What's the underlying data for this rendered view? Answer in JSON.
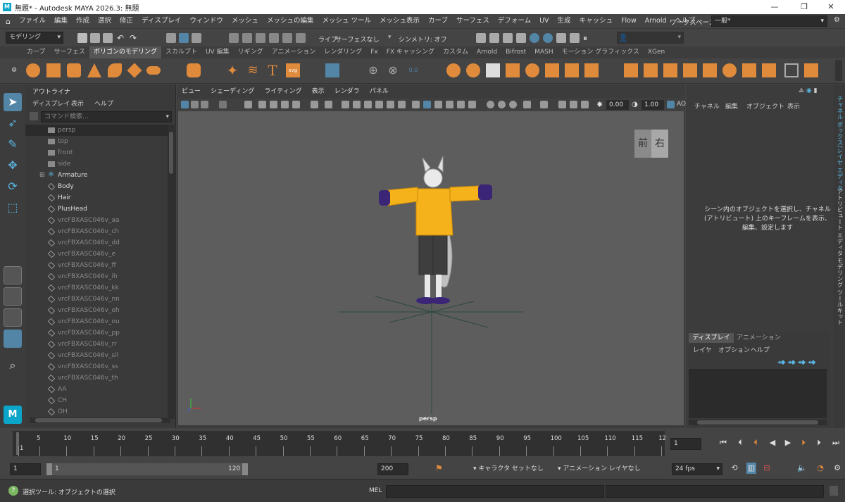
{
  "window": {
    "title": "無題* - Autodesk MAYA 2026.3: 無題",
    "logo": "M",
    "minimize": "—",
    "maximize": "❐",
    "close": "✕"
  },
  "menu": {
    "items": [
      "ファイル",
      "編集",
      "作成",
      "選択",
      "修正",
      "ディスプレイ",
      "ウィンドウ",
      "メッシュ",
      "メッシュの編集",
      "メッシュ ツール",
      "メッシュ表示",
      "カーブ",
      "サーフェス",
      "デフォーム",
      "UV",
      "生成",
      "キャッシュ",
      "Flow",
      "Arnold",
      "ヘルプ"
    ],
    "workspace_label": "ワークスペース:",
    "workspace_value": "一般*"
  },
  "status": {
    "mode": "モデリング",
    "live": "ライブ",
    "surface": "サーフェスなし",
    "symmetry": "シンメトリ: オフ"
  },
  "shelf_tabs": [
    "カーブ",
    "サーフェス",
    "ポリゴンのモデリング",
    "スカルプト",
    "UV 編集",
    "リギング",
    "アニメーション",
    "レンダリング",
    "Fx",
    "FX キャッシング",
    "カスタム",
    "Arnold",
    "Bifrost",
    "MASH",
    "モーション グラフィックス",
    "XGen"
  ],
  "shelf_active_tab": 2,
  "outliner": {
    "title": "アウトライナ",
    "menus": [
      "ディスプレイ",
      "表示",
      "ヘルプ"
    ],
    "search_placeholder": "コマンド検索...",
    "items": [
      {
        "name": "persp",
        "icon": "camera-icon",
        "style": "dim",
        "sel": true
      },
      {
        "name": "top",
        "icon": "camera-icon",
        "style": "dim"
      },
      {
        "name": "front",
        "icon": "camera-icon",
        "style": "dim"
      },
      {
        "name": "side",
        "icon": "camera-icon",
        "style": "dim"
      },
      {
        "name": "Armature",
        "icon": "joint-icon",
        "style": "lit",
        "expand": true
      },
      {
        "name": "Body",
        "icon": "mesh-icon",
        "style": "lit"
      },
      {
        "name": "Hair",
        "icon": "mesh-icon",
        "style": "lit"
      },
      {
        "name": "PlusHead",
        "icon": "mesh-icon",
        "style": "lit"
      },
      {
        "name": "vrcFBXASC046v_aa",
        "icon": "mesh-icon",
        "style": "dim"
      },
      {
        "name": "vrcFBXASC046v_ch",
        "icon": "mesh-icon",
        "style": "dim"
      },
      {
        "name": "vrcFBXASC046v_dd",
        "icon": "mesh-icon",
        "style": "dim"
      },
      {
        "name": "vrcFBXASC046v_e",
        "icon": "mesh-icon",
        "style": "dim"
      },
      {
        "name": "vrcFBXASC046v_ff",
        "icon": "mesh-icon",
        "style": "dim"
      },
      {
        "name": "vrcFBXASC046v_ih",
        "icon": "mesh-icon",
        "style": "dim"
      },
      {
        "name": "vrcFBXASC046v_kk",
        "icon": "mesh-icon",
        "style": "dim"
      },
      {
        "name": "vrcFBXASC046v_nn",
        "icon": "mesh-icon",
        "style": "dim"
      },
      {
        "name": "vrcFBXASC046v_oh",
        "icon": "mesh-icon",
        "style": "dim"
      },
      {
        "name": "vrcFBXASC046v_ou",
        "icon": "mesh-icon",
        "style": "dim"
      },
      {
        "name": "vrcFBXASC046v_pp",
        "icon": "mesh-icon",
        "style": "dim"
      },
      {
        "name": "vrcFBXASC046v_rr",
        "icon": "mesh-icon",
        "style": "dim"
      },
      {
        "name": "vrcFBXASC046v_sil",
        "icon": "mesh-icon",
        "style": "dim"
      },
      {
        "name": "vrcFBXASC046v_ss",
        "icon": "mesh-icon",
        "style": "dim"
      },
      {
        "name": "vrcFBXASC046v_th",
        "icon": "mesh-icon",
        "style": "dim"
      },
      {
        "name": "AA",
        "icon": "mesh-icon",
        "style": "dim"
      },
      {
        "name": "CH",
        "icon": "mesh-icon",
        "style": "dim"
      },
      {
        "name": "OH",
        "icon": "mesh-icon",
        "style": "dim"
      }
    ]
  },
  "viewport": {
    "menus": [
      "ビュー",
      "シェーディング",
      "ライティング",
      "表示",
      "レンダラ",
      "パネル"
    ],
    "field1": "0.00",
    "field2": "1.00",
    "ao": "AO",
    "camera": "persp",
    "cube_front": "前",
    "cube_right": "右"
  },
  "channel": {
    "menus": [
      "チャネル",
      "編集",
      "オブジェクト",
      "表示"
    ],
    "hint": "シーン内のオブジェクトを選択し、チャネル (アトリビュート) 上のキーフレームを表示、編集、設定します"
  },
  "layer": {
    "tabs": [
      "ディスプレイ",
      "アニメーション"
    ],
    "menus": [
      "レイヤ",
      "オプション",
      "ヘルプ"
    ]
  },
  "vtabs": [
    "チャネル ボックス/レイヤ エディタ",
    "アトリビュート エディタ",
    "モデリング ツールキット"
  ],
  "timeline": {
    "ticks": [
      "1",
      "5",
      "10",
      "15",
      "20",
      "25",
      "30",
      "35",
      "40",
      "45",
      "50",
      "55",
      "60",
      "65",
      "70",
      "75",
      "80",
      "85",
      "90",
      "95",
      "100",
      "105",
      "110",
      "115",
      "12"
    ],
    "current": "1"
  },
  "range": {
    "start": "1",
    "inner_start": "1",
    "inner_end": "120",
    "end": "200",
    "character_set": "キャラクタ セットなし",
    "anim_layer": "アニメーション レイヤなし",
    "fps": "24 fps"
  },
  "cmd": {
    "help": "選択ツール: オブジェクトの選択",
    "mel": "MEL"
  },
  "colors": {
    "accent": "#5285a6",
    "selection": "#2b2b2b",
    "shelf_orange": "#e08a3c",
    "hoodie": "#f5b21a",
    "purple": "#3a2577"
  }
}
